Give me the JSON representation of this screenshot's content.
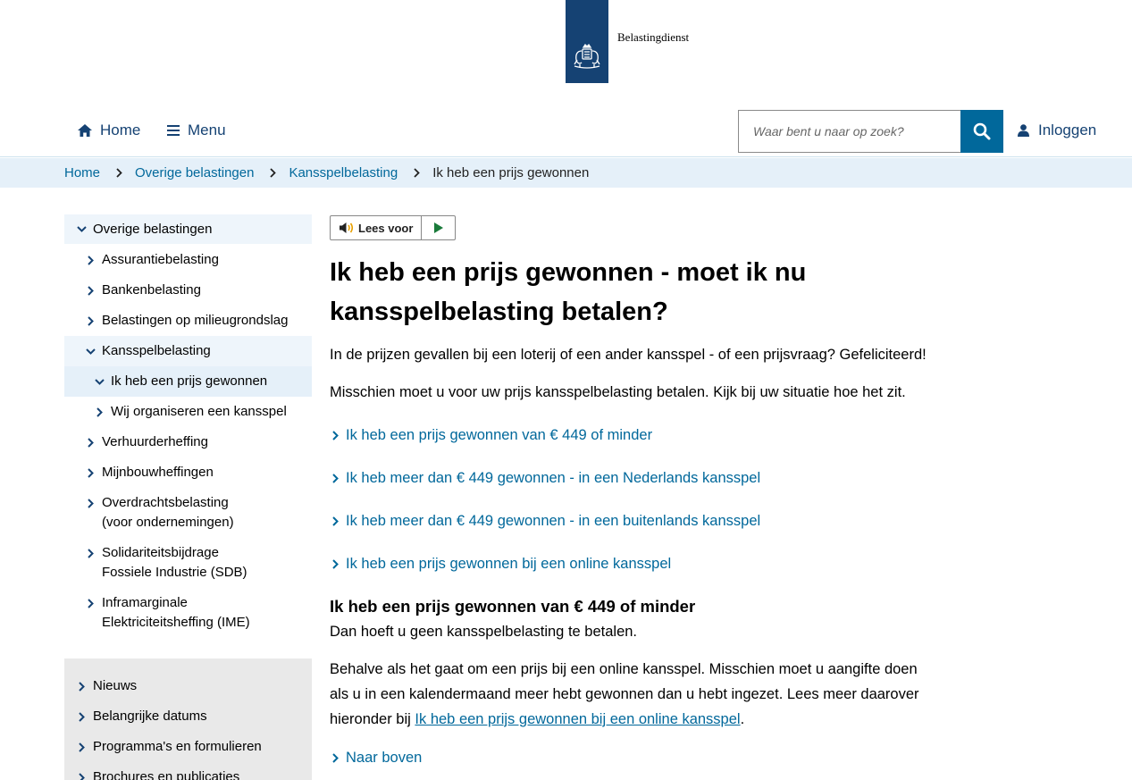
{
  "logo": {
    "name": "Belastingdienst"
  },
  "nav": {
    "home_label": "Home",
    "menu_label": "Menu",
    "search_placeholder": "Waar bent u naar op zoek?",
    "login_label": "Inloggen"
  },
  "breadcrumb": {
    "items": [
      "Home",
      "Overige belastingen",
      "Kansspelbelasting"
    ],
    "current": "Ik heb een prijs gewonnen"
  },
  "sidebar": {
    "top": "Overige belastingen",
    "items": [
      "Assurantiebelasting",
      "Bankenbelasting",
      "Belastingen op milieugrondslag",
      "Kansspelbelasting",
      "Ik heb een prijs gewonnen",
      "Wij organiseren een kansspel",
      "Verhuurderheffing",
      "Mijnbouwheffingen",
      "Overdrachtsbelasting (voor ondernemingen)",
      "Solidariteitsbijdrage Fossiele Industrie (SDB)",
      "Inframarginale Elektriciteitsheffing (IME)"
    ],
    "secondary": [
      "Nieuws",
      "Belangrijke datums",
      "Programma's en formulieren",
      "Brochures en publicaties"
    ]
  },
  "main": {
    "lees_voor": "Lees voor",
    "title": "Ik heb een prijs gewonnen - moet ik nu kansspelbelasting betalen?",
    "intro1": "In de prijzen gevallen bij een loterij of een ander kansspel - of een prijsvraag? Gefeliciteerd!",
    "intro2": "Misschien moet u voor uw prijs kansspelbelasting betalen. Kijk bij uw situatie hoe het zit.",
    "toc": [
      "Ik heb een prijs gewonnen van € 449 of minder",
      "Ik heb meer dan € 449 gewonnen - in een Nederlands kansspel",
      "Ik heb meer dan € 449 gewonnen - in een buitenlands kansspel",
      "Ik heb een prijs gewonnen bij een online kansspel"
    ],
    "section_title": "Ik heb een prijs gewonnen van € 449 of minder",
    "section_p1": "Dan hoeft u geen kansspelbelasting te betalen.",
    "section_p2_text": "Behalve als het gaat om een prijs bij een online kansspel. Misschien moet u aangifte doen als u in een kalendermaand meer hebt gewonnen dan u hebt ingezet. Lees meer daarover hieronder bij",
    "section_p2_link": "Ik heb een prijs gewonnen bij een online kansspel",
    "section_p2_end": ".",
    "back_to_top": "Naar boven"
  },
  "colors": {
    "brand": "#154273",
    "link": "#01689b",
    "breadcrumb_bg": "#e5f0f9",
    "sidebar_active_bg": "#eef5fb",
    "sidebar_secondary_bg": "#e9e9e9"
  }
}
